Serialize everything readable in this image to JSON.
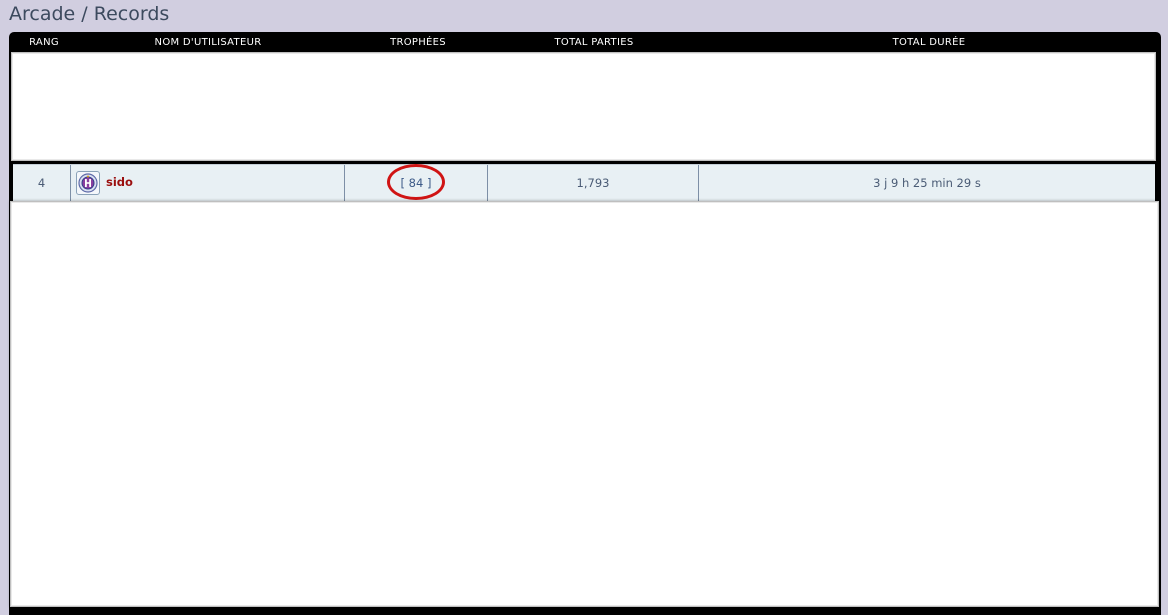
{
  "page": {
    "breadcrumb_section": "Arcade",
    "breadcrumb_separator": "/",
    "breadcrumb_page": "Records"
  },
  "table": {
    "columns": [
      "RANG",
      "NOM D'UTILISATEUR",
      "TROPHÉES",
      "TOTAL PARTIES",
      "TOTAL DURÉE"
    ],
    "row": {
      "rank": "4",
      "username": "sido",
      "trophies": "[ 84 ]",
      "total_parties": "1,793",
      "total_duration": "3 j 9 h 25 min 29 s"
    }
  },
  "icons": {
    "avatar": "user-avatar-icon"
  },
  "colors": {
    "background": "#d1cee0",
    "frame": "#000000",
    "row_background": "#e8f0f4",
    "username": "#9b0f0f",
    "highlight": "#d01414"
  }
}
